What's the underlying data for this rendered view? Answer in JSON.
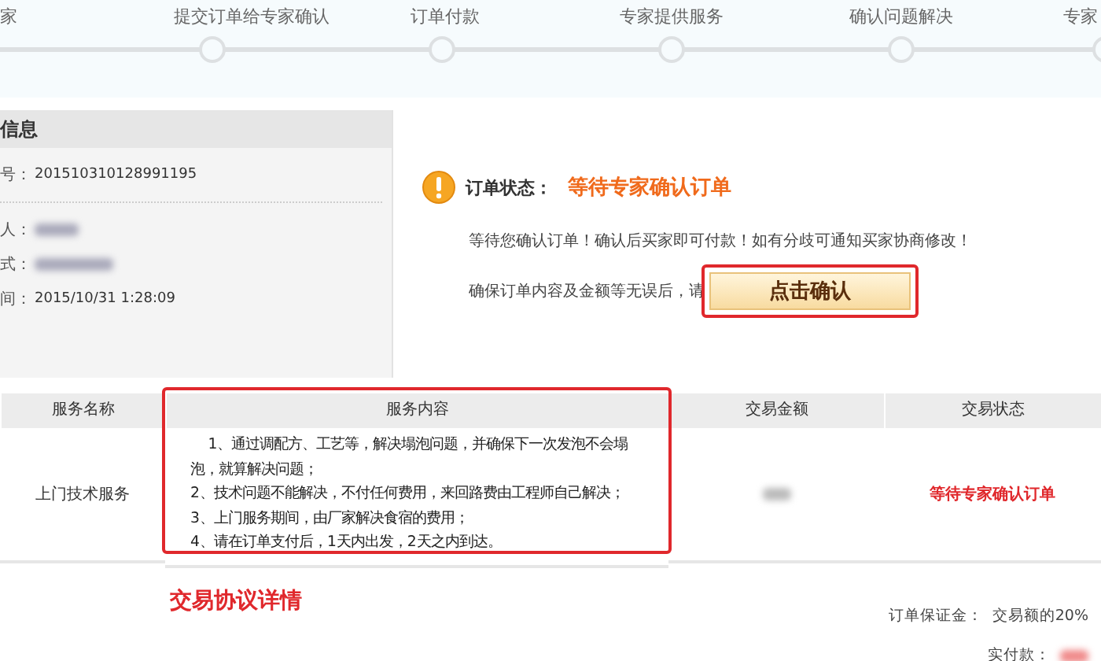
{
  "steps": [
    {
      "label": "家"
    },
    {
      "label": "提交订单给专家确认"
    },
    {
      "label": "订单付款"
    },
    {
      "label": "专家提供服务"
    },
    {
      "label": "确认问题解决"
    },
    {
      "label": "专家"
    }
  ],
  "info_panel": {
    "title": "信息",
    "rows": [
      {
        "label": "号：",
        "value": "201510310128991195",
        "redacted": false
      },
      {
        "label": "人：",
        "redacted": true
      },
      {
        "label": "式：",
        "redacted": true
      },
      {
        "label": "间：",
        "value": "2015/10/31 1:28:09",
        "redacted": false
      }
    ]
  },
  "status": {
    "label": "订单状态：",
    "value": "等待专家确认订单",
    "message": "等待您确认订单！确认后买家即可付款！如有分歧可通知买家协商修改！",
    "prompt": "确保订单内容及金额等无误后，请",
    "button": "点击确认"
  },
  "table": {
    "columns": [
      "服务名称",
      "服务内容",
      "交易金额",
      "交易状态"
    ],
    "rows": [
      {
        "name": "上门技术服务",
        "content": [
          "1、通过调配方、工艺等，解决塌泡问题，并确保下一次发泡不会塌泡，就算解决问题；",
          "2、技术问题不能解决，不付任何费用，来回路费由工程师自己解决；",
          "3、上门服务期间，由厂家解决食宿的费用；",
          "4、请在订单支付后，1天内出发，2天之内到达。"
        ],
        "status": "等待专家确认订单"
      }
    ]
  },
  "agreement_link": "交易协议详情",
  "summary": {
    "deposit_label": "订单保证金：",
    "deposit_value": "交易额的20%",
    "paid_label": "实付款："
  }
}
